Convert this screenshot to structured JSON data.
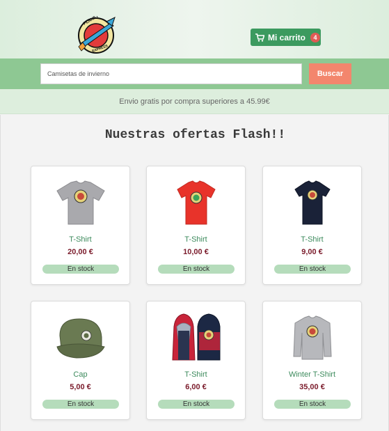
{
  "header": {
    "logo_text": "PLANET EXPRESS",
    "cart_label": "Mi carrito",
    "cart_count": "4"
  },
  "search": {
    "placeholder": "Camisetas de invierno",
    "button_label": "Buscar"
  },
  "shipping_notice": "Envio gratis por compra superiores a 45.99€",
  "section_title": "Nuestras ofertas Flash!!",
  "colors": {
    "brand_green": "#3c9a5f",
    "search_bar": "#8ec893",
    "search_button": "#f3866d",
    "badge": "#e05a55",
    "price": "#7a1a2a",
    "stock_pill": "#b5dcbb"
  },
  "products": [
    {
      "name": "T-Shirt",
      "price": "20,00 €",
      "stock": "En stock",
      "image": "grey-tshirt"
    },
    {
      "name": "T-Shirt",
      "price": "10,00 €",
      "stock": "En stock",
      "image": "red-tshirt"
    },
    {
      "name": "T-Shirt",
      "price": "9,00 €",
      "stock": "En stock",
      "image": "navy-tshirt"
    },
    {
      "name": "Cap",
      "price": "5,00 €",
      "stock": "En stock",
      "image": "olive-cap"
    },
    {
      "name": "T-Shirt",
      "price": "6,00 €",
      "stock": "En stock",
      "image": "hoodies"
    },
    {
      "name": "Winter T-Shirt",
      "price": "35,00 €",
      "stock": "En stock",
      "image": "grey-sweatshirt"
    }
  ]
}
